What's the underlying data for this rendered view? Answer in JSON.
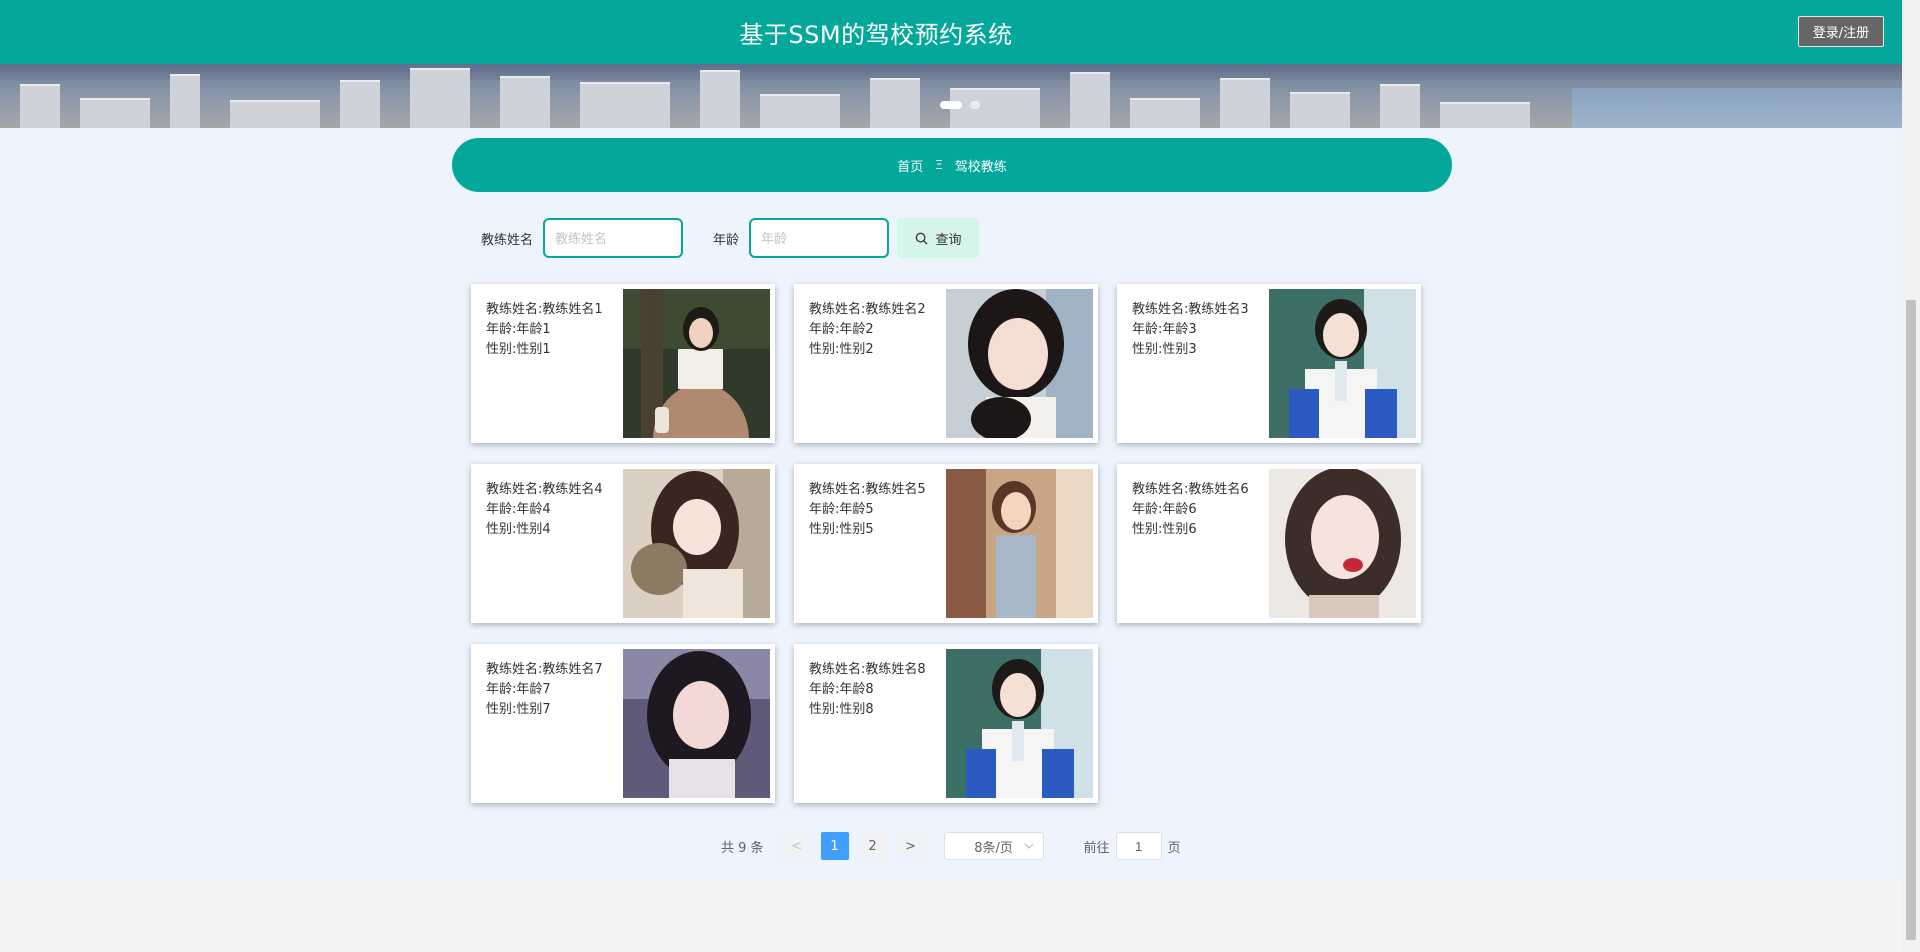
{
  "header": {
    "title": "基于SSM的驾校预约系统",
    "login_label": "登录/注册"
  },
  "breadcrumb": {
    "home": "首页",
    "separator": "Ξ",
    "current": "驾校教练"
  },
  "search": {
    "name_label": "教练姓名",
    "name_placeholder": "教练姓名",
    "age_label": "年龄",
    "age_placeholder": "年龄",
    "button_label": "查询"
  },
  "coaches": [
    {
      "name": "教练姓名:教练姓名1",
      "age": "年龄:年龄1",
      "gender": "性别:性别1"
    },
    {
      "name": "教练姓名:教练姓名2",
      "age": "年龄:年龄2",
      "gender": "性别:性别2"
    },
    {
      "name": "教练姓名:教练姓名3",
      "age": "年龄:年龄3",
      "gender": "性别:性别3"
    },
    {
      "name": "教练姓名:教练姓名4",
      "age": "年龄:年龄4",
      "gender": "性别:性别4"
    },
    {
      "name": "教练姓名:教练姓名5",
      "age": "年龄:年龄5",
      "gender": "性别:性别5"
    },
    {
      "name": "教练姓名:教练姓名6",
      "age": "年龄:年龄6",
      "gender": "性别:性别6"
    },
    {
      "name": "教练姓名:教练姓名7",
      "age": "年龄:年龄7",
      "gender": "性别:性别7"
    },
    {
      "name": "教练姓名:教练姓名8",
      "age": "年龄:年龄8",
      "gender": "性别:性别8"
    }
  ],
  "pagination": {
    "total_text": "共 9 条",
    "prev": "<",
    "pages": [
      "1",
      "2"
    ],
    "next": ">",
    "page_size": "8条/页",
    "goto_prefix": "前往",
    "goto_value": "1",
    "goto_suffix": "页"
  },
  "colors": {
    "primary": "#03a89a",
    "page_bg": "#edf4fe",
    "active_page": "#409eff",
    "search_button_bg": "#d5f5e8"
  }
}
